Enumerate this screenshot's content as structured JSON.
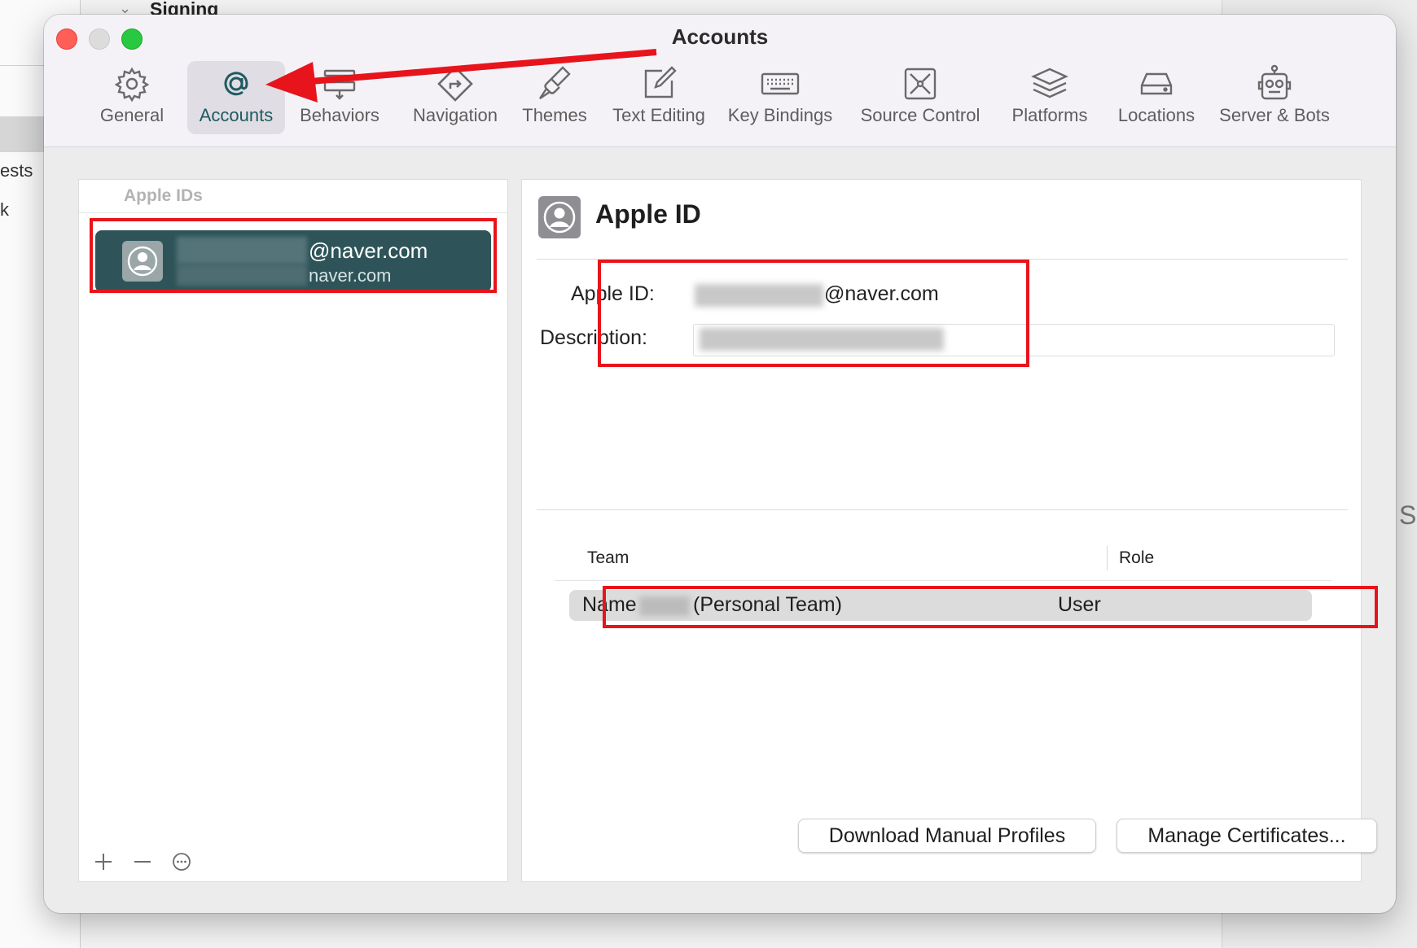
{
  "background": {
    "top_title": "Signing",
    "left_text_1": "ests",
    "left_text_2": "k",
    "right_text": "S"
  },
  "window": {
    "title": "Accounts"
  },
  "toolbar": {
    "items": [
      {
        "label": "General",
        "icon": "gear-icon",
        "active": false
      },
      {
        "label": "Accounts",
        "icon": "at-sign-icon",
        "active": true
      },
      {
        "label": "Behaviors",
        "icon": "behaviors-icon",
        "active": false
      },
      {
        "label": "Navigation",
        "icon": "navigation-icon",
        "active": false
      },
      {
        "label": "Themes",
        "icon": "paintbrush-icon",
        "active": false
      },
      {
        "label": "Text Editing",
        "icon": "text-edit-icon",
        "active": false
      },
      {
        "label": "Key Bindings",
        "icon": "keyboard-icon",
        "active": false
      },
      {
        "label": "Source Control",
        "icon": "source-control-icon",
        "active": false
      },
      {
        "label": "Platforms",
        "icon": "layers-icon",
        "active": false
      },
      {
        "label": "Locations",
        "icon": "drive-icon",
        "active": false
      },
      {
        "label": "Server & Bots",
        "icon": "robot-icon",
        "active": false
      }
    ]
  },
  "left_panel": {
    "header": "Apple IDs",
    "account": {
      "email_domain": "@naver.com",
      "description_domain": "naver.com"
    }
  },
  "right_panel": {
    "title": "Apple ID",
    "apple_id_label": "Apple ID:",
    "apple_id_domain": "@naver.com",
    "description_label": "Description:",
    "table": {
      "headers": {
        "team": "Team",
        "role": "Role"
      },
      "rows": [
        {
          "name_prefix": "Name",
          "name_suffix": "(Personal Team)",
          "role": "User"
        }
      ]
    },
    "buttons": {
      "download": "Download Manual Profiles",
      "certificates": "Manage Certificates..."
    }
  },
  "colors": {
    "annotation_red": "#e8141c",
    "selection": "#2e5459",
    "active_tab_text": "#1f5a61"
  }
}
